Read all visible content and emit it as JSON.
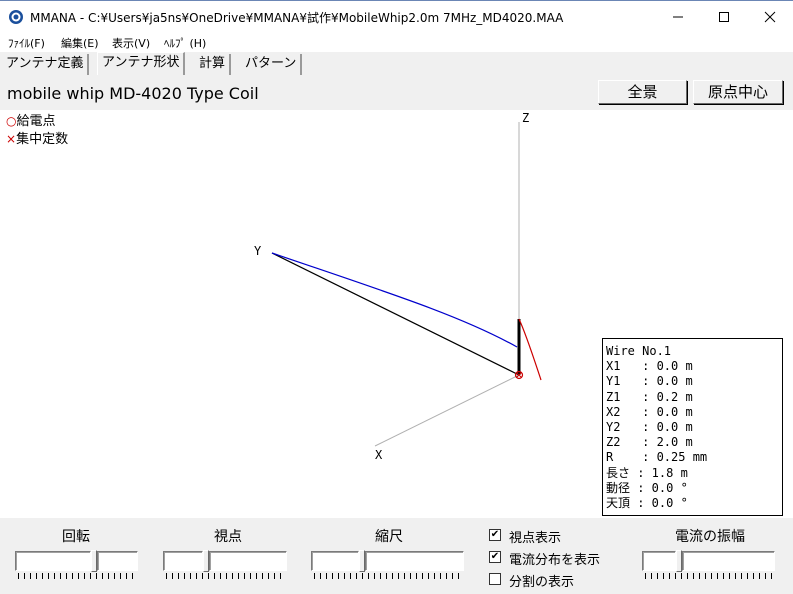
{
  "window": {
    "title": "MMANA - C:¥Users¥ja5ns¥OneDrive¥MMANA¥試作¥MobileWhip2.0m 7MHz_MD4020.MAA"
  },
  "menu": [
    "ﾌｧｲﾙ(F)",
    "編集(E)",
    "表示(V)",
    "ﾍﾙﾌﾟ (H)"
  ],
  "tabs": [
    "アンテナ定義",
    "アンテナ形状",
    "計算",
    "パターン"
  ],
  "active_tab": "アンテナ形状",
  "header": {
    "model_title": "mobile whip  MD-4020 Type Coil",
    "btn_full_view": "全景",
    "btn_origin_center": "原点中心"
  },
  "legend": {
    "feed_mark": "○",
    "feed_label": "給電点",
    "load_mark": "×",
    "load_label": "集中定数"
  },
  "axes": {
    "x": "X",
    "y": "Y",
    "z": "Z"
  },
  "info": {
    "lines": [
      "Wire No.1",
      "X1   : 0.0 m",
      "Y1   : 0.0 m",
      "Z1   : 0.2 m",
      "X2   : 0.0 m",
      "Y2   : 0.0 m",
      "Z2   : 2.0 m",
      "R    : 0.25 mm",
      "長さ : 1.8 m",
      "動径 : 0.0 °",
      "天頂 : 0.0 °"
    ]
  },
  "controls": {
    "rotate": "回転",
    "viewpoint": "視点",
    "scale": "縮尺",
    "current_amplitude": "電流の振幅",
    "checkboxes": [
      {
        "label": "視点表示",
        "checked": true
      },
      {
        "label": "電流分布を表示",
        "checked": true
      },
      {
        "label": "分割の表示",
        "checked": false
      }
    ]
  },
  "colors": {
    "current_line": "#0000cc",
    "current_curve": "#cc0000",
    "feed_marker": "#cc0000"
  }
}
